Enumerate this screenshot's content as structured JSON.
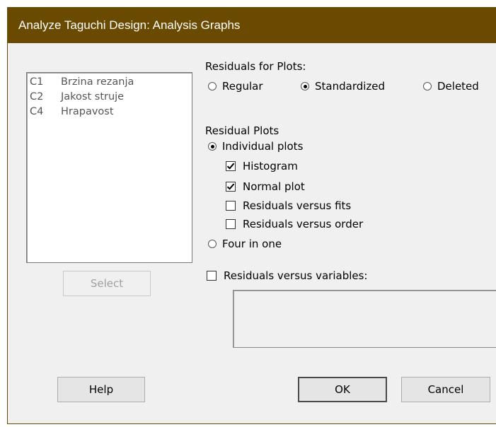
{
  "window": {
    "title": "Analyze Taguchi Design: Analysis Graphs"
  },
  "variables": [
    {
      "col": "C1",
      "name": "Brzina rezanja"
    },
    {
      "col": "C2",
      "name": "Jakost struje"
    },
    {
      "col": "C4",
      "name": "Hrapavost"
    }
  ],
  "select_label": "Select",
  "residuals_for_plots": {
    "heading": "Residuals for Plots:",
    "options": {
      "regular": "Regular",
      "standardized": "Standardized",
      "deleted": "Deleted"
    },
    "selected": "Standardized"
  },
  "residual_plots": {
    "heading": "Residual Plots",
    "individual": "Individual plots",
    "histogram": "Histogram",
    "normal": "Normal plot",
    "vs_fits": "Residuals versus fits",
    "vs_order": "Residuals versus order",
    "four_in_one": "Four in one",
    "selected": "Individual plots",
    "checked": {
      "histogram": true,
      "normal": true,
      "vs_fits": false,
      "vs_order": false
    }
  },
  "vs_variables": {
    "label": "Residuals versus variables:",
    "checked": false,
    "value": ""
  },
  "buttons": {
    "help": "Help",
    "ok": "OK",
    "cancel": "Cancel"
  },
  "colors": {
    "titlebar": "#6a4a00",
    "title_text": "#ffffff",
    "dialog_bg": "#f0f0f0"
  }
}
